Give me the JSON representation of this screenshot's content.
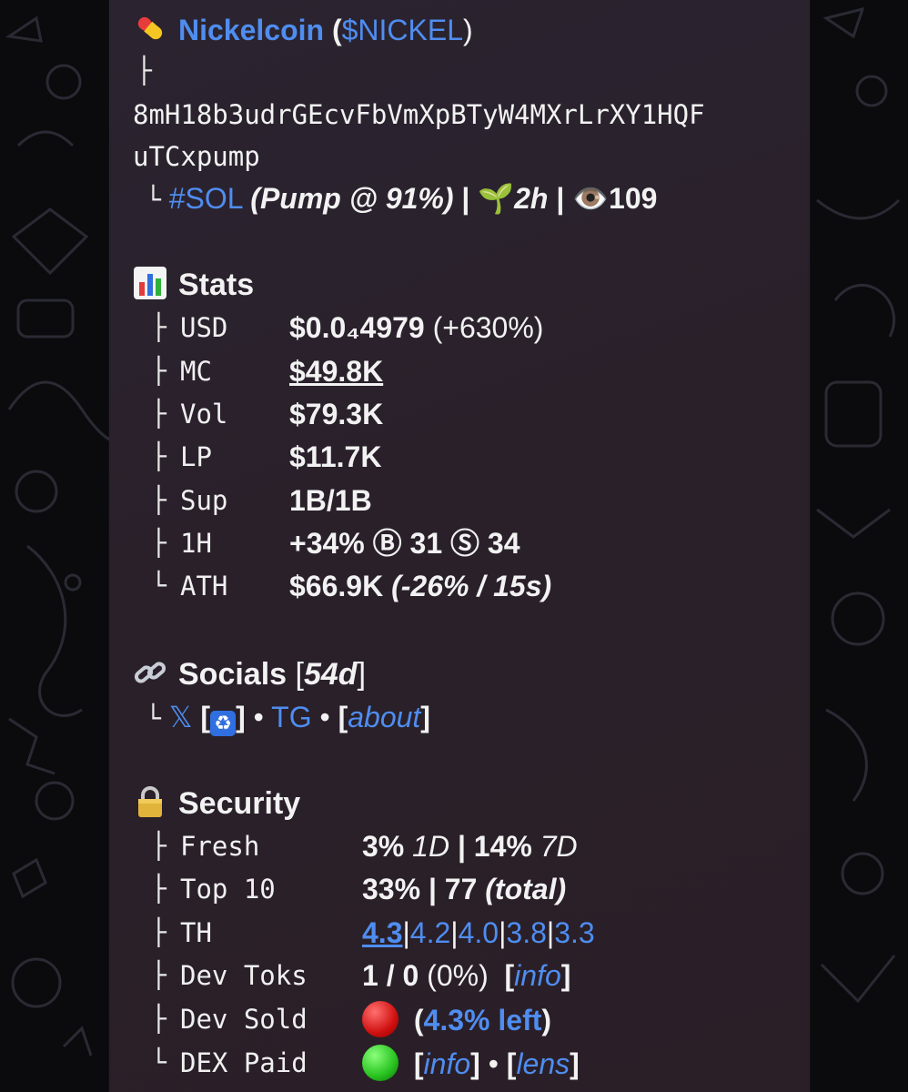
{
  "header": {
    "pill_icon": "pill-emoji",
    "name": "Nickelcoin",
    "open_paren": "(",
    "ticker": "$NICKEL",
    "close_paren": ")",
    "branch": "├",
    "address_line1": "8mH18b3udrGEcvFbVmXpBTyW4MXrLrXY1HQF",
    "address_line2": "uTCxpump",
    "last_branch": "└",
    "chain": "#SOL",
    "pump": "(Pump @ 91%)",
    "sep": "|",
    "age": "2h",
    "views": "109"
  },
  "stats": {
    "title": "Stats",
    "icon": "bar-chart-emoji",
    "rows": [
      {
        "branch": "├",
        "label": "USD",
        "value": "$0.0₄4979",
        "extra": "(+630%)"
      },
      {
        "branch": "├",
        "label": "MC",
        "value": "$49.8K"
      },
      {
        "branch": "├",
        "label": "Vol",
        "value": "$79.3K"
      },
      {
        "branch": "├",
        "label": "LP",
        "value": "$11.7K"
      },
      {
        "branch": "├",
        "label": "Sup",
        "value": "1B/1B"
      },
      {
        "branch": "├",
        "label": "1H",
        "value": "+34% Ⓑ 31 Ⓢ 34"
      },
      {
        "branch": "└",
        "label": "ATH",
        "value": "$66.9K",
        "extra": "(-26% / 15s)"
      }
    ]
  },
  "socials": {
    "title": "Socials",
    "age_open": "[",
    "age": "54d",
    "age_close": "]",
    "branch": "└",
    "x": "𝕏",
    "bracket_open": "[",
    "bracket_close": "]",
    "bullet": "•",
    "tg": "TG",
    "about": "about"
  },
  "security": {
    "title": "Security",
    "icon": "lock-emoji",
    "fresh": {
      "branch": "├",
      "label": "Fresh",
      "v1": "3%",
      "p1": "1D",
      "sep": "|",
      "v2": "14%",
      "p2": "7D"
    },
    "top10": {
      "branch": "├",
      "label": "Top 10",
      "v1": "33%",
      "sep": "|",
      "v2": "77",
      "p2": "(total)"
    },
    "th": {
      "branch": "├",
      "label": "TH",
      "values": [
        "4.3",
        "4.2",
        "4.0",
        "3.8",
        "3.3"
      ],
      "sep": "|"
    },
    "dev_toks": {
      "branch": "├",
      "label": "Dev Toks",
      "v1": "1 / 0",
      "pct": "(0%)",
      "info": "info"
    },
    "dev_sold": {
      "branch": "├",
      "label": "Dev Sold",
      "status": "red",
      "left": "4.3% left"
    },
    "dex_paid": {
      "branch": "└",
      "label": "DEX Paid",
      "status": "green",
      "info": "info",
      "lens": "lens"
    }
  },
  "colors": {
    "link": "#4f8df0",
    "bubble": "#2a2129",
    "background": "#0b0b0d"
  }
}
